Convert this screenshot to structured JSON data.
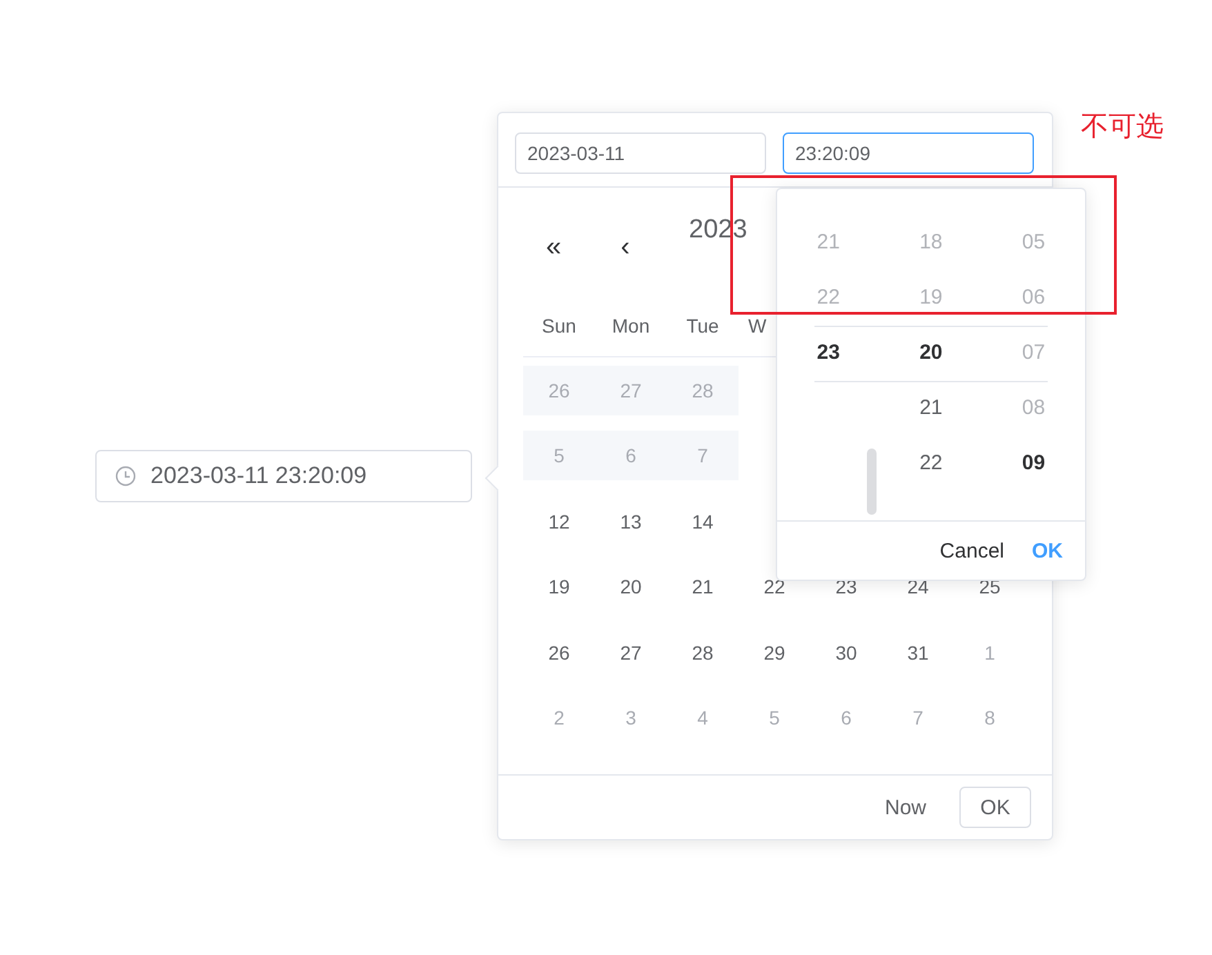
{
  "trigger": {
    "value": "2023-03-11 23:20:09"
  },
  "panel": {
    "date_input": "2023-03-11",
    "time_input": {
      "value": "23:20:09",
      "focused": true
    },
    "nav": [
      "«",
      "‹"
    ],
    "year": "2023",
    "weekdays": [
      "Sun",
      "Mon",
      "Tue",
      "W"
    ],
    "weeks": [
      [
        {
          "text": "26",
          "kind": "disabled"
        },
        {
          "text": "27",
          "kind": "disabled"
        },
        {
          "text": "28",
          "kind": "disabled"
        }
      ],
      [
        {
          "text": "5",
          "kind": "disabled"
        },
        {
          "text": "6",
          "kind": "disabled"
        },
        {
          "text": "7",
          "kind": "disabled"
        }
      ],
      [
        {
          "text": "12",
          "kind": "current"
        },
        {
          "text": "13",
          "kind": "current"
        },
        {
          "text": "14",
          "kind": "current"
        }
      ],
      [
        {
          "text": "19",
          "kind": "current"
        },
        {
          "text": "20",
          "kind": "current"
        },
        {
          "text": "21",
          "kind": "current"
        },
        {
          "text": "22",
          "kind": "current"
        },
        {
          "text": "23",
          "kind": "current"
        },
        {
          "text": "24",
          "kind": "current"
        },
        {
          "text": "25",
          "kind": "current"
        }
      ],
      [
        {
          "text": "26",
          "kind": "current"
        },
        {
          "text": "27",
          "kind": "current"
        },
        {
          "text": "28",
          "kind": "current"
        },
        {
          "text": "29",
          "kind": "current"
        },
        {
          "text": "30",
          "kind": "current"
        },
        {
          "text": "31",
          "kind": "current"
        },
        {
          "text": "1",
          "kind": "other"
        }
      ],
      [
        {
          "text": "2",
          "kind": "other"
        },
        {
          "text": "3",
          "kind": "other"
        },
        {
          "text": "4",
          "kind": "other"
        },
        {
          "text": "5",
          "kind": "other"
        },
        {
          "text": "6",
          "kind": "other"
        },
        {
          "text": "7",
          "kind": "other"
        },
        {
          "text": "8",
          "kind": "other"
        }
      ]
    ],
    "footer": {
      "now": "Now",
      "ok": "OK"
    }
  },
  "time_picker": {
    "columns": [
      [
        {
          "text": "21",
          "disabled": true,
          "selected": false
        },
        {
          "text": "22",
          "disabled": true,
          "selected": false
        },
        {
          "text": "23",
          "disabled": false,
          "selected": true
        }
      ],
      [
        {
          "text": "18",
          "disabled": true,
          "selected": false
        },
        {
          "text": "19",
          "disabled": true,
          "selected": false
        },
        {
          "text": "20",
          "disabled": false,
          "selected": true
        },
        {
          "text": "21",
          "disabled": false,
          "selected": false
        },
        {
          "text": "22",
          "disabled": false,
          "selected": false
        }
      ],
      [
        {
          "text": "05",
          "disabled": true,
          "selected": false
        },
        {
          "text": "06",
          "disabled": true,
          "selected": false
        },
        {
          "text": "07",
          "disabled": true,
          "selected": false
        },
        {
          "text": "08",
          "disabled": true,
          "selected": false
        },
        {
          "text": "09",
          "disabled": false,
          "selected": true
        }
      ]
    ],
    "cancel": "Cancel",
    "ok": "OK"
  },
  "annotation": {
    "label": "不可选"
  }
}
